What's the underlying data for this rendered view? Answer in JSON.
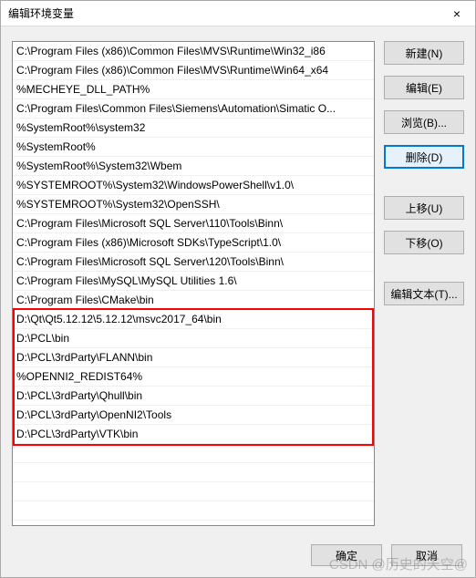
{
  "window": {
    "title": "编辑环境变量",
    "close_label": "×"
  },
  "entries": [
    "C:\\Program Files (x86)\\Common Files\\MVS\\Runtime\\Win32_i86",
    "C:\\Program Files (x86)\\Common Files\\MVS\\Runtime\\Win64_x64",
    "%MECHEYE_DLL_PATH%",
    "C:\\Program Files\\Common Files\\Siemens\\Automation\\Simatic O...",
    "%SystemRoot%\\system32",
    "%SystemRoot%",
    "%SystemRoot%\\System32\\Wbem",
    "%SYSTEMROOT%\\System32\\WindowsPowerShell\\v1.0\\",
    "%SYSTEMROOT%\\System32\\OpenSSH\\",
    "C:\\Program Files\\Microsoft SQL Server\\110\\Tools\\Binn\\",
    "C:\\Program Files (x86)\\Microsoft SDKs\\TypeScript\\1.0\\",
    "C:\\Program Files\\Microsoft SQL Server\\120\\Tools\\Binn\\",
    "C:\\Program Files\\MySQL\\MySQL Utilities 1.6\\",
    "C:\\Program Files\\CMake\\bin",
    "D:\\Qt\\Qt5.12.12\\5.12.12\\msvc2017_64\\bin",
    "D:\\PCL\\bin",
    "D:\\PCL\\3rdParty\\FLANN\\bin",
    "%OPENNI2_REDIST64%",
    "D:\\PCL\\3rdParty\\Qhull\\bin",
    "D:\\PCL\\3rdParty\\OpenNI2\\Tools",
    "D:\\PCL\\3rdParty\\VTK\\bin",
    "",
    "",
    "",
    ""
  ],
  "highlight": {
    "start_index": 14,
    "end_index": 20
  },
  "buttons": {
    "new": "新建(N)",
    "edit": "编辑(E)",
    "browse": "浏览(B)...",
    "delete": "删除(D)",
    "moveup": "上移(U)",
    "movedown": "下移(O)",
    "edittext": "编辑文本(T)..."
  },
  "footer": {
    "ok": "确定",
    "cancel": "取消"
  },
  "watermark": "CSDN @历史的天空@"
}
